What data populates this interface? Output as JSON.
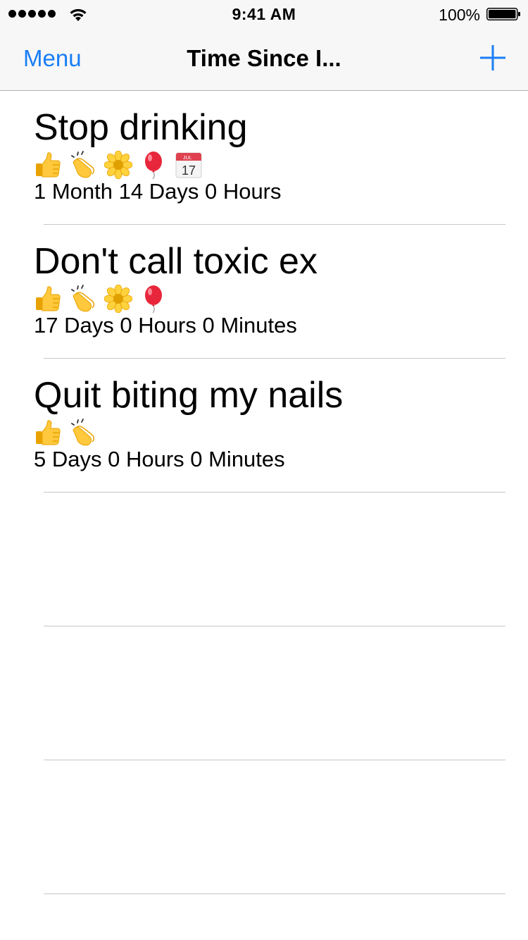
{
  "status_bar": {
    "time": "9:41 AM",
    "battery_percent": "100%",
    "signal_bars": 5,
    "icons": [
      "signal-dots-icon",
      "wifi-icon",
      "battery-icon"
    ]
  },
  "nav": {
    "left_label": "Menu",
    "title": "Time Since I...",
    "right_icon": "plus-icon",
    "accent_color": "#1a7ef5"
  },
  "items": [
    {
      "title": "Stop drinking",
      "badges": [
        "thumbs-up-icon",
        "clapping-hands-icon",
        "sunflower-icon",
        "balloon-icon",
        "calendar-icon"
      ],
      "calendar_badge": {
        "month": "JUL",
        "day": "17"
      },
      "elapsed": "1 Month 14 Days 0 Hours"
    },
    {
      "title": "Don't call toxic ex",
      "badges": [
        "thumbs-up-icon",
        "clapping-hands-icon",
        "sunflower-icon",
        "balloon-icon"
      ],
      "elapsed": "17 Days 0 Hours 0 Minutes"
    },
    {
      "title": "Quit biting my nails",
      "badges": [
        "thumbs-up-icon",
        "clapping-hands-icon"
      ],
      "elapsed": "5 Days 0 Hours 0 Minutes"
    }
  ],
  "empty_rows": 3
}
